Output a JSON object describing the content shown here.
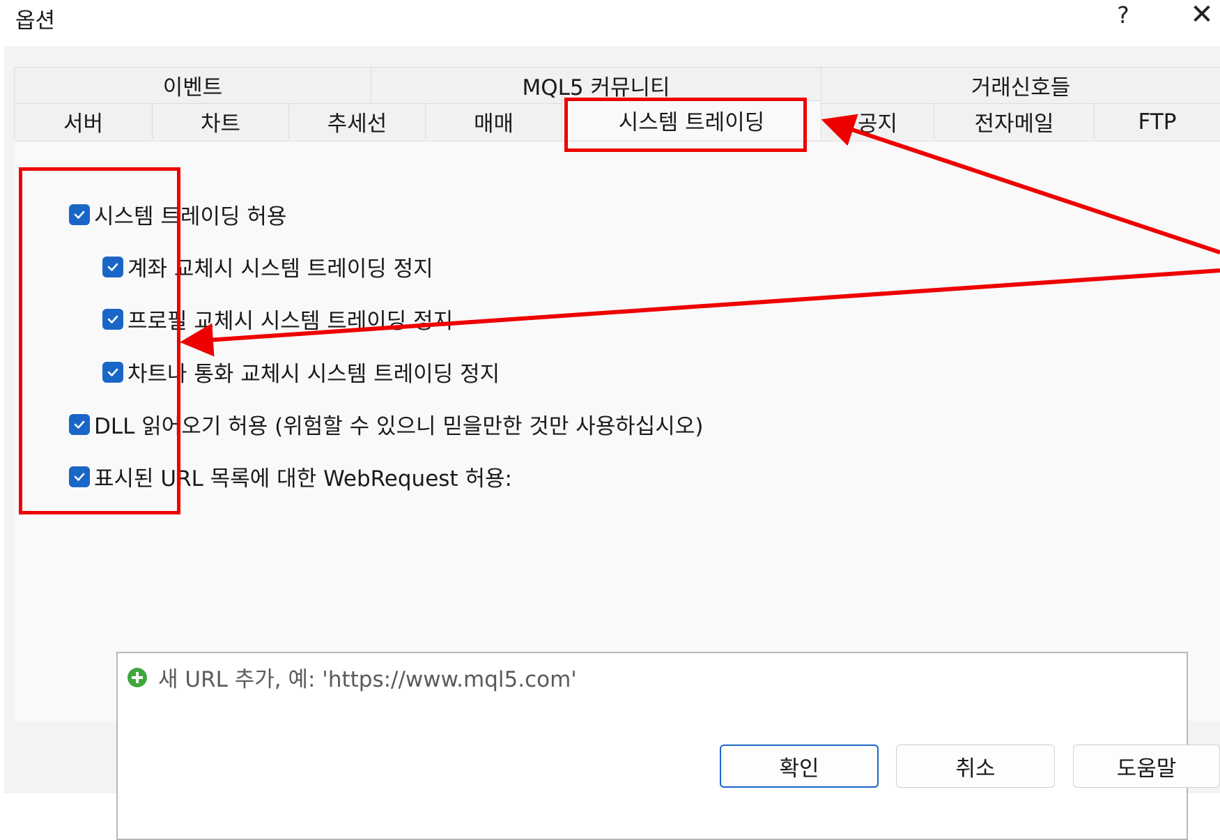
{
  "window": {
    "title": "옵션",
    "help_label": "?",
    "close_label": "✕"
  },
  "tabs": {
    "row1": [
      "이벤트",
      "MQL5 커뮤니티",
      "거래신호들"
    ],
    "row2": [
      "서버",
      "차트",
      "추세선",
      "매매",
      "시스템 트레이딩",
      "공지",
      "전자메일",
      "FTP"
    ],
    "active": "시스템 트레이딩"
  },
  "options": {
    "allow_algo": "시스템 트레이딩 허용",
    "stop_on_account": "계좌 교체시 시스템 트레이딩 정지",
    "stop_on_profile": "프로필 교체시 시스템 트레이딩 정지",
    "stop_on_chart": "차트나 통화 교체시 시스템 트레이딩 정지",
    "allow_dll": "DLL 읽어오기 허용 (위험할 수 있으니 믿을만한 것만 사용하십시오)",
    "allow_webrequest": "표시된 URL 목록에 대한 WebRequest 허용:",
    "checked": [
      true,
      true,
      true,
      true,
      true,
      true
    ]
  },
  "url_list": {
    "add_placeholder": "새 URL 추가, 예: 'https://www.mql5.com'"
  },
  "buttons": {
    "ok": "확인",
    "cancel": "취소",
    "help": "도움말"
  },
  "colors": {
    "checkbox": "#1a66c7",
    "annotation": "#ee0000",
    "add_icon": "#3ea83e"
  }
}
